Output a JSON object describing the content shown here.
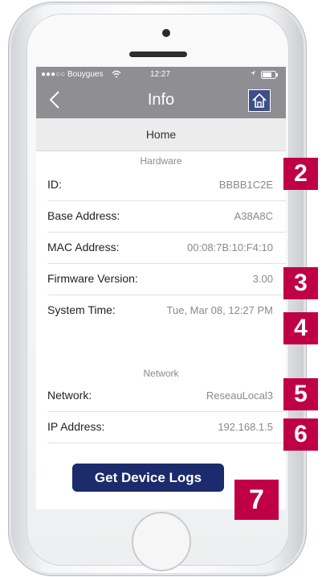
{
  "status_bar": {
    "carrier": "●●●○○ Bouygues",
    "time": "12:27"
  },
  "nav": {
    "title": "Info"
  },
  "breadcrumb": "Home",
  "hardware": {
    "header": "Hardware",
    "rows": [
      {
        "label": "ID:",
        "value": "BBBB1C2E"
      },
      {
        "label": "Base Address:",
        "value": "A38A8C"
      },
      {
        "label": "MAC Address:",
        "value": "00:08:7B:10:F4:10"
      },
      {
        "label": "Firmware Version:",
        "value": "3.00"
      },
      {
        "label": "System Time:",
        "value": "Tue, Mar 08, 12:27 PM"
      }
    ]
  },
  "network": {
    "header": "Network",
    "rows": [
      {
        "label": "Network:",
        "value": "ReseauLocal3"
      },
      {
        "label": "IP Address:",
        "value": "192.168.1.5"
      }
    ]
  },
  "get_logs_label": "Get Device Logs",
  "callouts": [
    "2",
    "3",
    "4",
    "5",
    "6",
    "7"
  ],
  "colors": {
    "nav_bar": "#8e8e93",
    "button": "#1c2b6b",
    "callout": "#c00045"
  }
}
